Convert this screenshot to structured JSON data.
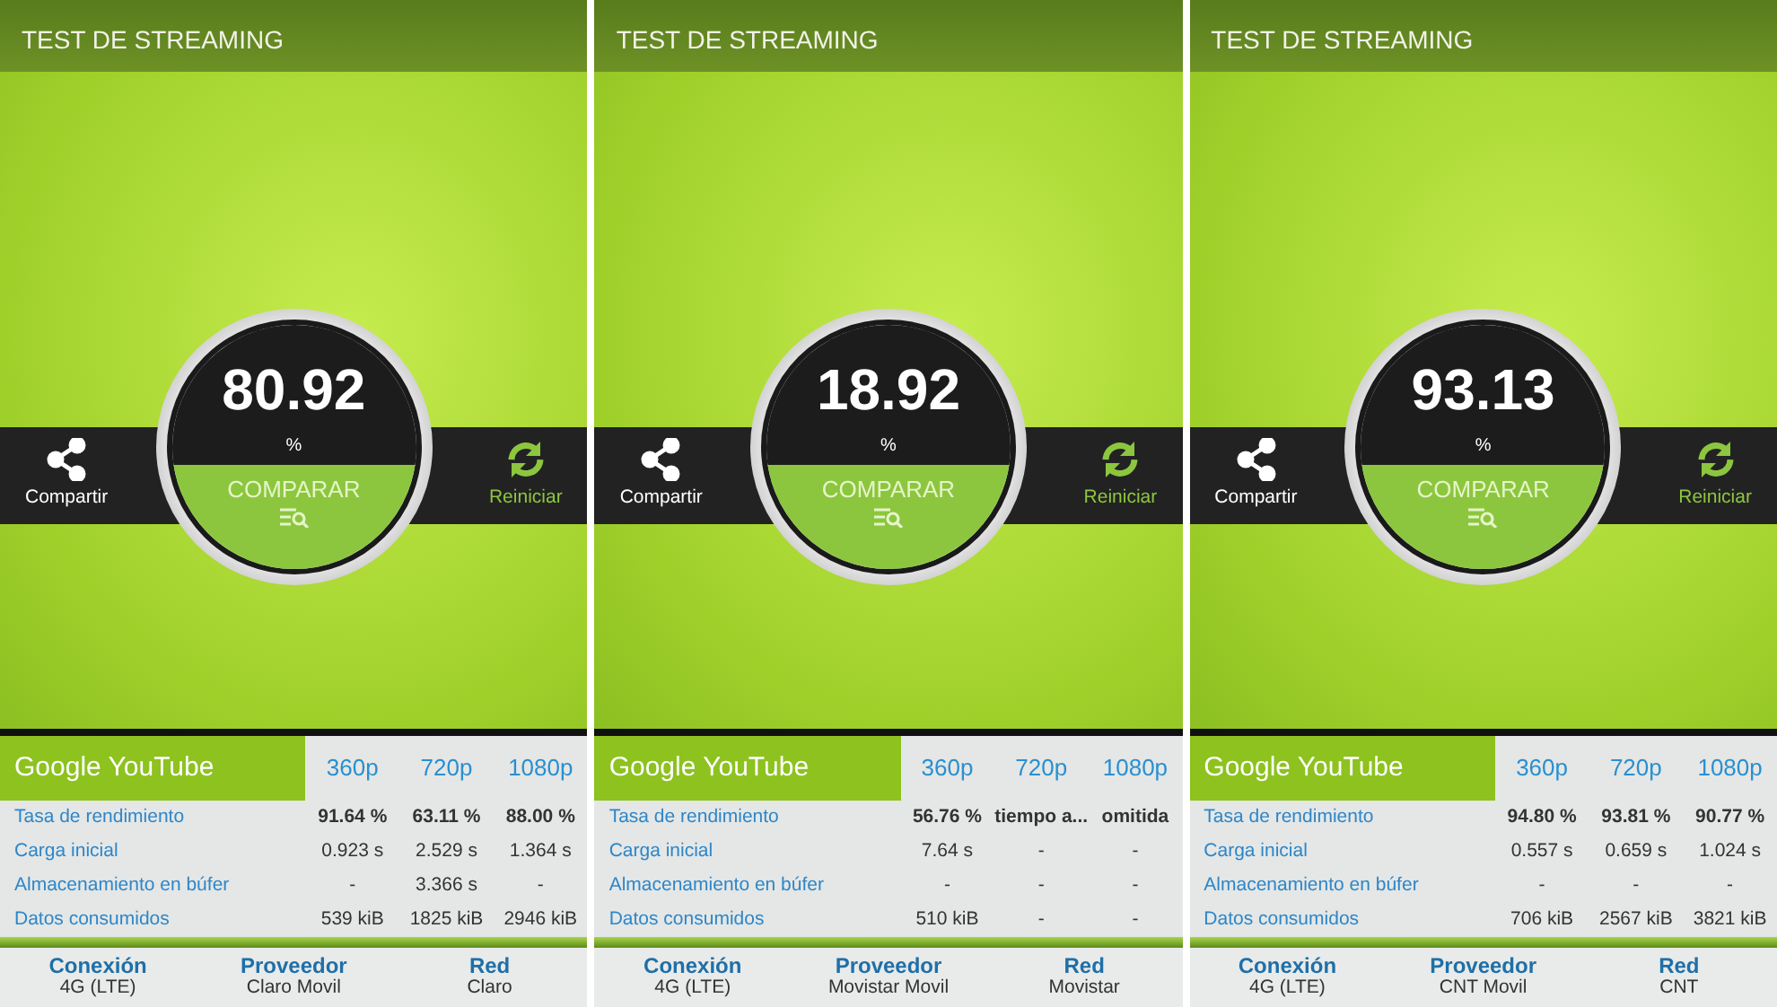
{
  "panels": [
    {
      "title": "TEST DE STREAMING",
      "score": "80.92",
      "unit": "%",
      "share_label": "Compartir",
      "compare_label": "COMPARAR",
      "restart_label": "Reiniciar",
      "service": "Google YouTube",
      "columns": [
        "360p",
        "720p",
        "1080p"
      ],
      "rows": [
        {
          "label": "Tasa de rendimiento",
          "values": [
            "91.64 %",
            "63.11 %",
            "88.00 %"
          ]
        },
        {
          "label": "Carga inicial",
          "values": [
            "0.923 s",
            "2.529 s",
            "1.364 s"
          ]
        },
        {
          "label": "Almacenamiento en búfer",
          "values": [
            "-",
            "3.366 s",
            "-"
          ]
        },
        {
          "label": "Datos consumidos",
          "values": [
            "539 kiB",
            "1825 kiB",
            "2946 kiB"
          ]
        }
      ],
      "footer": [
        {
          "heading": "Conexión",
          "value": "4G (LTE)"
        },
        {
          "heading": "Proveedor",
          "value": "Claro Movil"
        },
        {
          "heading": "Red",
          "value": "Claro"
        }
      ]
    },
    {
      "title": "TEST DE STREAMING",
      "score": "18.92",
      "unit": "%",
      "share_label": "Compartir",
      "compare_label": "COMPARAR",
      "restart_label": "Reiniciar",
      "service": "Google YouTube",
      "columns": [
        "360p",
        "720p",
        "1080p"
      ],
      "rows": [
        {
          "label": "Tasa de rendimiento",
          "values": [
            "56.76 %",
            "tiempo a...",
            "omitida"
          ]
        },
        {
          "label": "Carga inicial",
          "values": [
            "7.64 s",
            "-",
            "-"
          ]
        },
        {
          "label": "Almacenamiento en búfer",
          "values": [
            "-",
            "-",
            "-"
          ]
        },
        {
          "label": "Datos consumidos",
          "values": [
            "510 kiB",
            "-",
            "-"
          ]
        }
      ],
      "footer": [
        {
          "heading": "Conexión",
          "value": "4G (LTE)"
        },
        {
          "heading": "Proveedor",
          "value": "Movistar Movil"
        },
        {
          "heading": "Red",
          "value": "Movistar"
        }
      ]
    },
    {
      "title": "TEST DE STREAMING",
      "score": "93.13",
      "unit": "%",
      "share_label": "Compartir",
      "compare_label": "COMPARAR",
      "restart_label": "Reiniciar",
      "service": "Google YouTube",
      "columns": [
        "360p",
        "720p",
        "1080p"
      ],
      "rows": [
        {
          "label": "Tasa de rendimiento",
          "values": [
            "94.80 %",
            "93.81 %",
            "90.77 %"
          ]
        },
        {
          "label": "Carga inicial",
          "values": [
            "0.557 s",
            "0.659 s",
            "1.024 s"
          ]
        },
        {
          "label": "Almacenamiento en búfer",
          "values": [
            "-",
            "-",
            "-"
          ]
        },
        {
          "label": "Datos consumidos",
          "values": [
            "706 kiB",
            "2567 kiB",
            "3821 kiB"
          ]
        }
      ],
      "footer": [
        {
          "heading": "Conexión",
          "value": "4G (LTE)"
        },
        {
          "heading": "Proveedor",
          "value": "CNT Movil"
        },
        {
          "heading": "Red",
          "value": "CNT"
        }
      ]
    }
  ]
}
